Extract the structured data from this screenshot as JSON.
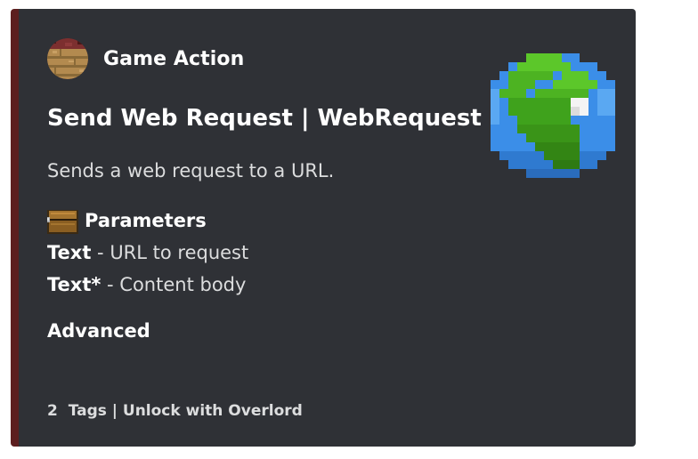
{
  "embed": {
    "accent_color": "#5c1f1f",
    "background_color": "#2f3136",
    "author": {
      "name": "Game Action",
      "avatar_icon": "netherrack-planks-block-icon"
    },
    "title": "Send Web Request | WebRequest",
    "description": "Sends a web request to a URL.",
    "parameters": {
      "heading_icon": "chest-icon",
      "heading": "Parameters",
      "items": [
        {
          "type": "Text",
          "separator": " - ",
          "description": "URL to request"
        },
        {
          "type": "Text*",
          "separator": " - ",
          "description": "Content body"
        }
      ]
    },
    "advanced": "Advanced",
    "footer": {
      "count": "2",
      "text": "Tags | Unlock with Overlord"
    },
    "thumbnail_icon": "pixel-earth-globe-icon"
  }
}
